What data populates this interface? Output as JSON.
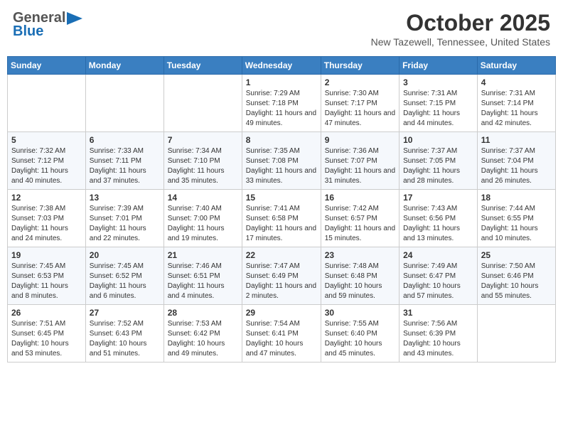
{
  "header": {
    "logo_line1": "General",
    "logo_line2": "Blue",
    "month": "October 2025",
    "location": "New Tazewell, Tennessee, United States"
  },
  "weekdays": [
    "Sunday",
    "Monday",
    "Tuesday",
    "Wednesday",
    "Thursday",
    "Friday",
    "Saturday"
  ],
  "weeks": [
    [
      {
        "day": "",
        "sunrise": "",
        "sunset": "",
        "daylight": ""
      },
      {
        "day": "",
        "sunrise": "",
        "sunset": "",
        "daylight": ""
      },
      {
        "day": "",
        "sunrise": "",
        "sunset": "",
        "daylight": ""
      },
      {
        "day": "1",
        "sunrise": "Sunrise: 7:29 AM",
        "sunset": "Sunset: 7:18 PM",
        "daylight": "Daylight: 11 hours and 49 minutes."
      },
      {
        "day": "2",
        "sunrise": "Sunrise: 7:30 AM",
        "sunset": "Sunset: 7:17 PM",
        "daylight": "Daylight: 11 hours and 47 minutes."
      },
      {
        "day": "3",
        "sunrise": "Sunrise: 7:31 AM",
        "sunset": "Sunset: 7:15 PM",
        "daylight": "Daylight: 11 hours and 44 minutes."
      },
      {
        "day": "4",
        "sunrise": "Sunrise: 7:31 AM",
        "sunset": "Sunset: 7:14 PM",
        "daylight": "Daylight: 11 hours and 42 minutes."
      }
    ],
    [
      {
        "day": "5",
        "sunrise": "Sunrise: 7:32 AM",
        "sunset": "Sunset: 7:12 PM",
        "daylight": "Daylight: 11 hours and 40 minutes."
      },
      {
        "day": "6",
        "sunrise": "Sunrise: 7:33 AM",
        "sunset": "Sunset: 7:11 PM",
        "daylight": "Daylight: 11 hours and 37 minutes."
      },
      {
        "day": "7",
        "sunrise": "Sunrise: 7:34 AM",
        "sunset": "Sunset: 7:10 PM",
        "daylight": "Daylight: 11 hours and 35 minutes."
      },
      {
        "day": "8",
        "sunrise": "Sunrise: 7:35 AM",
        "sunset": "Sunset: 7:08 PM",
        "daylight": "Daylight: 11 hours and 33 minutes."
      },
      {
        "day": "9",
        "sunrise": "Sunrise: 7:36 AM",
        "sunset": "Sunset: 7:07 PM",
        "daylight": "Daylight: 11 hours and 31 minutes."
      },
      {
        "day": "10",
        "sunrise": "Sunrise: 7:37 AM",
        "sunset": "Sunset: 7:05 PM",
        "daylight": "Daylight: 11 hours and 28 minutes."
      },
      {
        "day": "11",
        "sunrise": "Sunrise: 7:37 AM",
        "sunset": "Sunset: 7:04 PM",
        "daylight": "Daylight: 11 hours and 26 minutes."
      }
    ],
    [
      {
        "day": "12",
        "sunrise": "Sunrise: 7:38 AM",
        "sunset": "Sunset: 7:03 PM",
        "daylight": "Daylight: 11 hours and 24 minutes."
      },
      {
        "day": "13",
        "sunrise": "Sunrise: 7:39 AM",
        "sunset": "Sunset: 7:01 PM",
        "daylight": "Daylight: 11 hours and 22 minutes."
      },
      {
        "day": "14",
        "sunrise": "Sunrise: 7:40 AM",
        "sunset": "Sunset: 7:00 PM",
        "daylight": "Daylight: 11 hours and 19 minutes."
      },
      {
        "day": "15",
        "sunrise": "Sunrise: 7:41 AM",
        "sunset": "Sunset: 6:58 PM",
        "daylight": "Daylight: 11 hours and 17 minutes."
      },
      {
        "day": "16",
        "sunrise": "Sunrise: 7:42 AM",
        "sunset": "Sunset: 6:57 PM",
        "daylight": "Daylight: 11 hours and 15 minutes."
      },
      {
        "day": "17",
        "sunrise": "Sunrise: 7:43 AM",
        "sunset": "Sunset: 6:56 PM",
        "daylight": "Daylight: 11 hours and 13 minutes."
      },
      {
        "day": "18",
        "sunrise": "Sunrise: 7:44 AM",
        "sunset": "Sunset: 6:55 PM",
        "daylight": "Daylight: 11 hours and 10 minutes."
      }
    ],
    [
      {
        "day": "19",
        "sunrise": "Sunrise: 7:45 AM",
        "sunset": "Sunset: 6:53 PM",
        "daylight": "Daylight: 11 hours and 8 minutes."
      },
      {
        "day": "20",
        "sunrise": "Sunrise: 7:45 AM",
        "sunset": "Sunset: 6:52 PM",
        "daylight": "Daylight: 11 hours and 6 minutes."
      },
      {
        "day": "21",
        "sunrise": "Sunrise: 7:46 AM",
        "sunset": "Sunset: 6:51 PM",
        "daylight": "Daylight: 11 hours and 4 minutes."
      },
      {
        "day": "22",
        "sunrise": "Sunrise: 7:47 AM",
        "sunset": "Sunset: 6:49 PM",
        "daylight": "Daylight: 11 hours and 2 minutes."
      },
      {
        "day": "23",
        "sunrise": "Sunrise: 7:48 AM",
        "sunset": "Sunset: 6:48 PM",
        "daylight": "Daylight: 10 hours and 59 minutes."
      },
      {
        "day": "24",
        "sunrise": "Sunrise: 7:49 AM",
        "sunset": "Sunset: 6:47 PM",
        "daylight": "Daylight: 10 hours and 57 minutes."
      },
      {
        "day": "25",
        "sunrise": "Sunrise: 7:50 AM",
        "sunset": "Sunset: 6:46 PM",
        "daylight": "Daylight: 10 hours and 55 minutes."
      }
    ],
    [
      {
        "day": "26",
        "sunrise": "Sunrise: 7:51 AM",
        "sunset": "Sunset: 6:45 PM",
        "daylight": "Daylight: 10 hours and 53 minutes."
      },
      {
        "day": "27",
        "sunrise": "Sunrise: 7:52 AM",
        "sunset": "Sunset: 6:43 PM",
        "daylight": "Daylight: 10 hours and 51 minutes."
      },
      {
        "day": "28",
        "sunrise": "Sunrise: 7:53 AM",
        "sunset": "Sunset: 6:42 PM",
        "daylight": "Daylight: 10 hours and 49 minutes."
      },
      {
        "day": "29",
        "sunrise": "Sunrise: 7:54 AM",
        "sunset": "Sunset: 6:41 PM",
        "daylight": "Daylight: 10 hours and 47 minutes."
      },
      {
        "day": "30",
        "sunrise": "Sunrise: 7:55 AM",
        "sunset": "Sunset: 6:40 PM",
        "daylight": "Daylight: 10 hours and 45 minutes."
      },
      {
        "day": "31",
        "sunrise": "Sunrise: 7:56 AM",
        "sunset": "Sunset: 6:39 PM",
        "daylight": "Daylight: 10 hours and 43 minutes."
      },
      {
        "day": "",
        "sunrise": "",
        "sunset": "",
        "daylight": ""
      }
    ]
  ]
}
